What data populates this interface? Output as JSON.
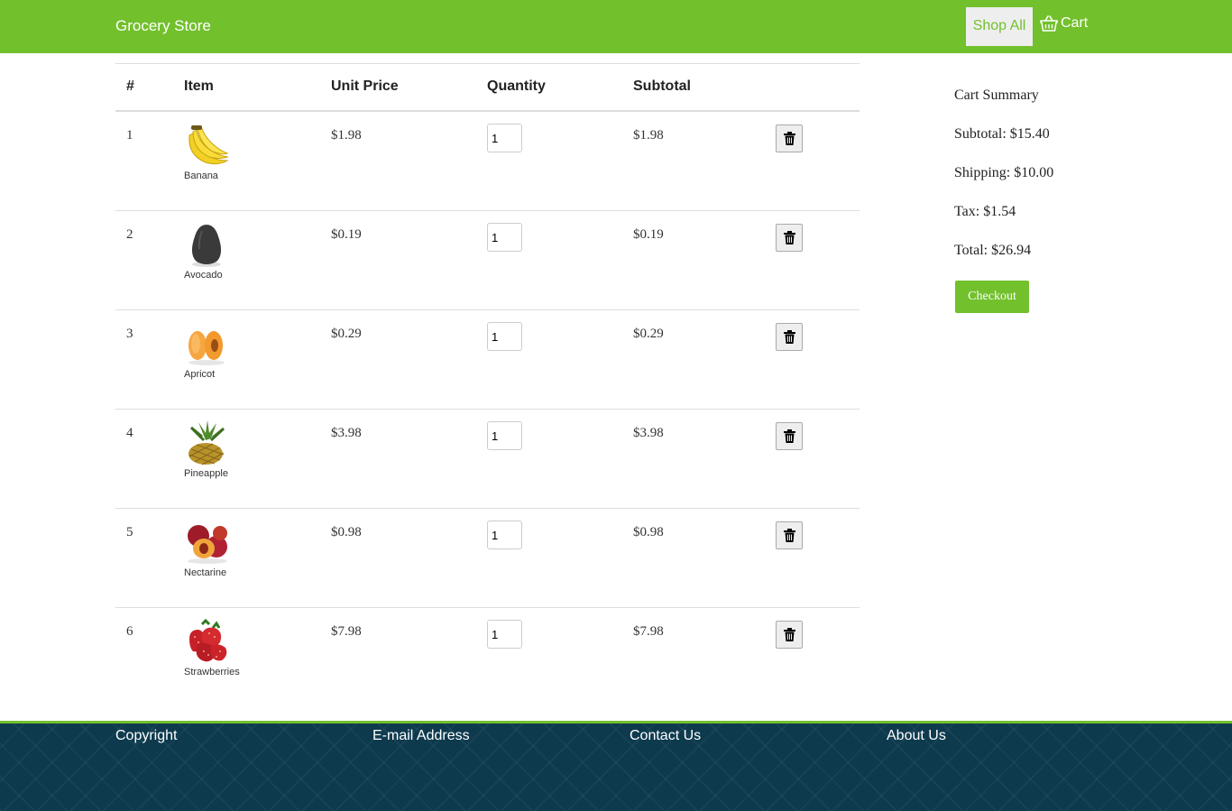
{
  "navbar": {
    "brand": "Grocery Store",
    "shop_all": "Shop All",
    "cart": "Cart",
    "accent_color": "#72c02c"
  },
  "table": {
    "headers": [
      "#",
      "Item",
      "Unit Price",
      "Quantity",
      "Subtotal"
    ],
    "rows": [
      {
        "num": "1",
        "name": "Banana",
        "price": "$1.98",
        "qty": "1",
        "subtotal": "$1.98",
        "icon": "banana-icon"
      },
      {
        "num": "2",
        "name": "Avocado",
        "price": "$0.19",
        "qty": "1",
        "subtotal": "$0.19",
        "icon": "avocado-icon"
      },
      {
        "num": "3",
        "name": "Apricot",
        "price": "$0.29",
        "qty": "1",
        "subtotal": "$0.29",
        "icon": "apricot-icon"
      },
      {
        "num": "4",
        "name": "Pineapple",
        "price": "$3.98",
        "qty": "1",
        "subtotal": "$3.98",
        "icon": "pineapple-icon"
      },
      {
        "num": "5",
        "name": "Nectarine",
        "price": "$0.98",
        "qty": "1",
        "subtotal": "$0.98",
        "icon": "nectarine-icon"
      },
      {
        "num": "6",
        "name": "Strawberries",
        "price": "$7.98",
        "qty": "1",
        "subtotal": "$7.98",
        "icon": "strawberries-icon"
      }
    ]
  },
  "summary": {
    "title": "Cart Summary",
    "subtotal": "Subtotal: $15.40",
    "shipping": "Shipping: $10.00",
    "tax": "Tax: $1.54",
    "total": "Total: $26.94",
    "checkout": "Checkout"
  },
  "footer": {
    "copyright": "Copyright",
    "email": "E-mail Address",
    "contact": "Contact Us",
    "about": "About Us",
    "background_color": "#0e3a4e"
  }
}
